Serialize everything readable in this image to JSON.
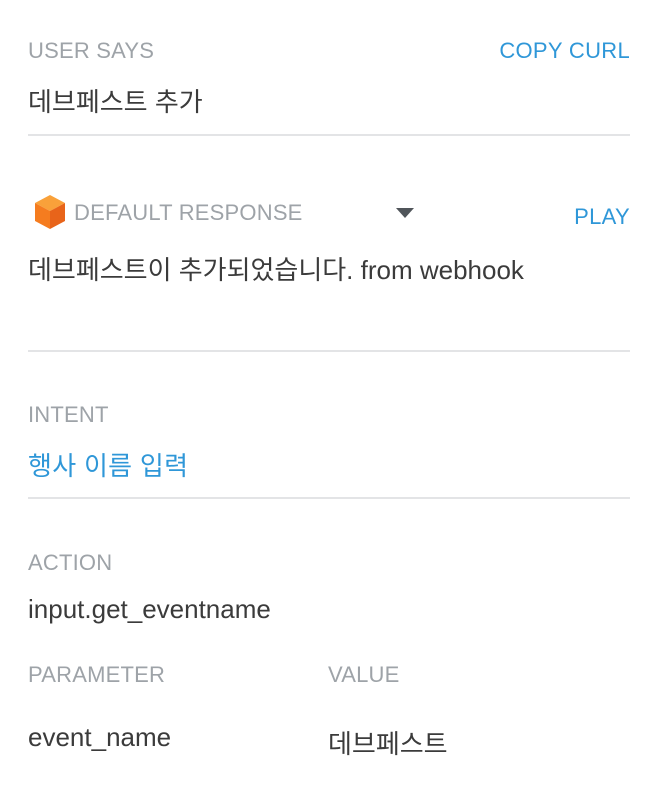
{
  "user_says": {
    "label": "USER SAYS",
    "copy_curl_label": "COPY CURL",
    "text": "데브페스트 추가"
  },
  "response": {
    "label": "DEFAULT RESPONSE",
    "play_label": "PLAY",
    "text": "데브페스트이 추가되었습니다. from webhook",
    "icon": "agent-cube-icon"
  },
  "intent": {
    "label": "INTENT",
    "name": "행사 이름 입력"
  },
  "action": {
    "label": "ACTION",
    "name": "input.get_eventname"
  },
  "parameters": {
    "header_parameter": "PARAMETER",
    "header_value": "VALUE",
    "rows": [
      {
        "name": "event_name",
        "value": "데브페스트"
      }
    ]
  },
  "colors": {
    "link": "#2f97d8",
    "label": "#9ea3a8",
    "text": "#3b3b3b",
    "divider": "#e3e4e6",
    "icon_orange": "#f57c1f"
  }
}
